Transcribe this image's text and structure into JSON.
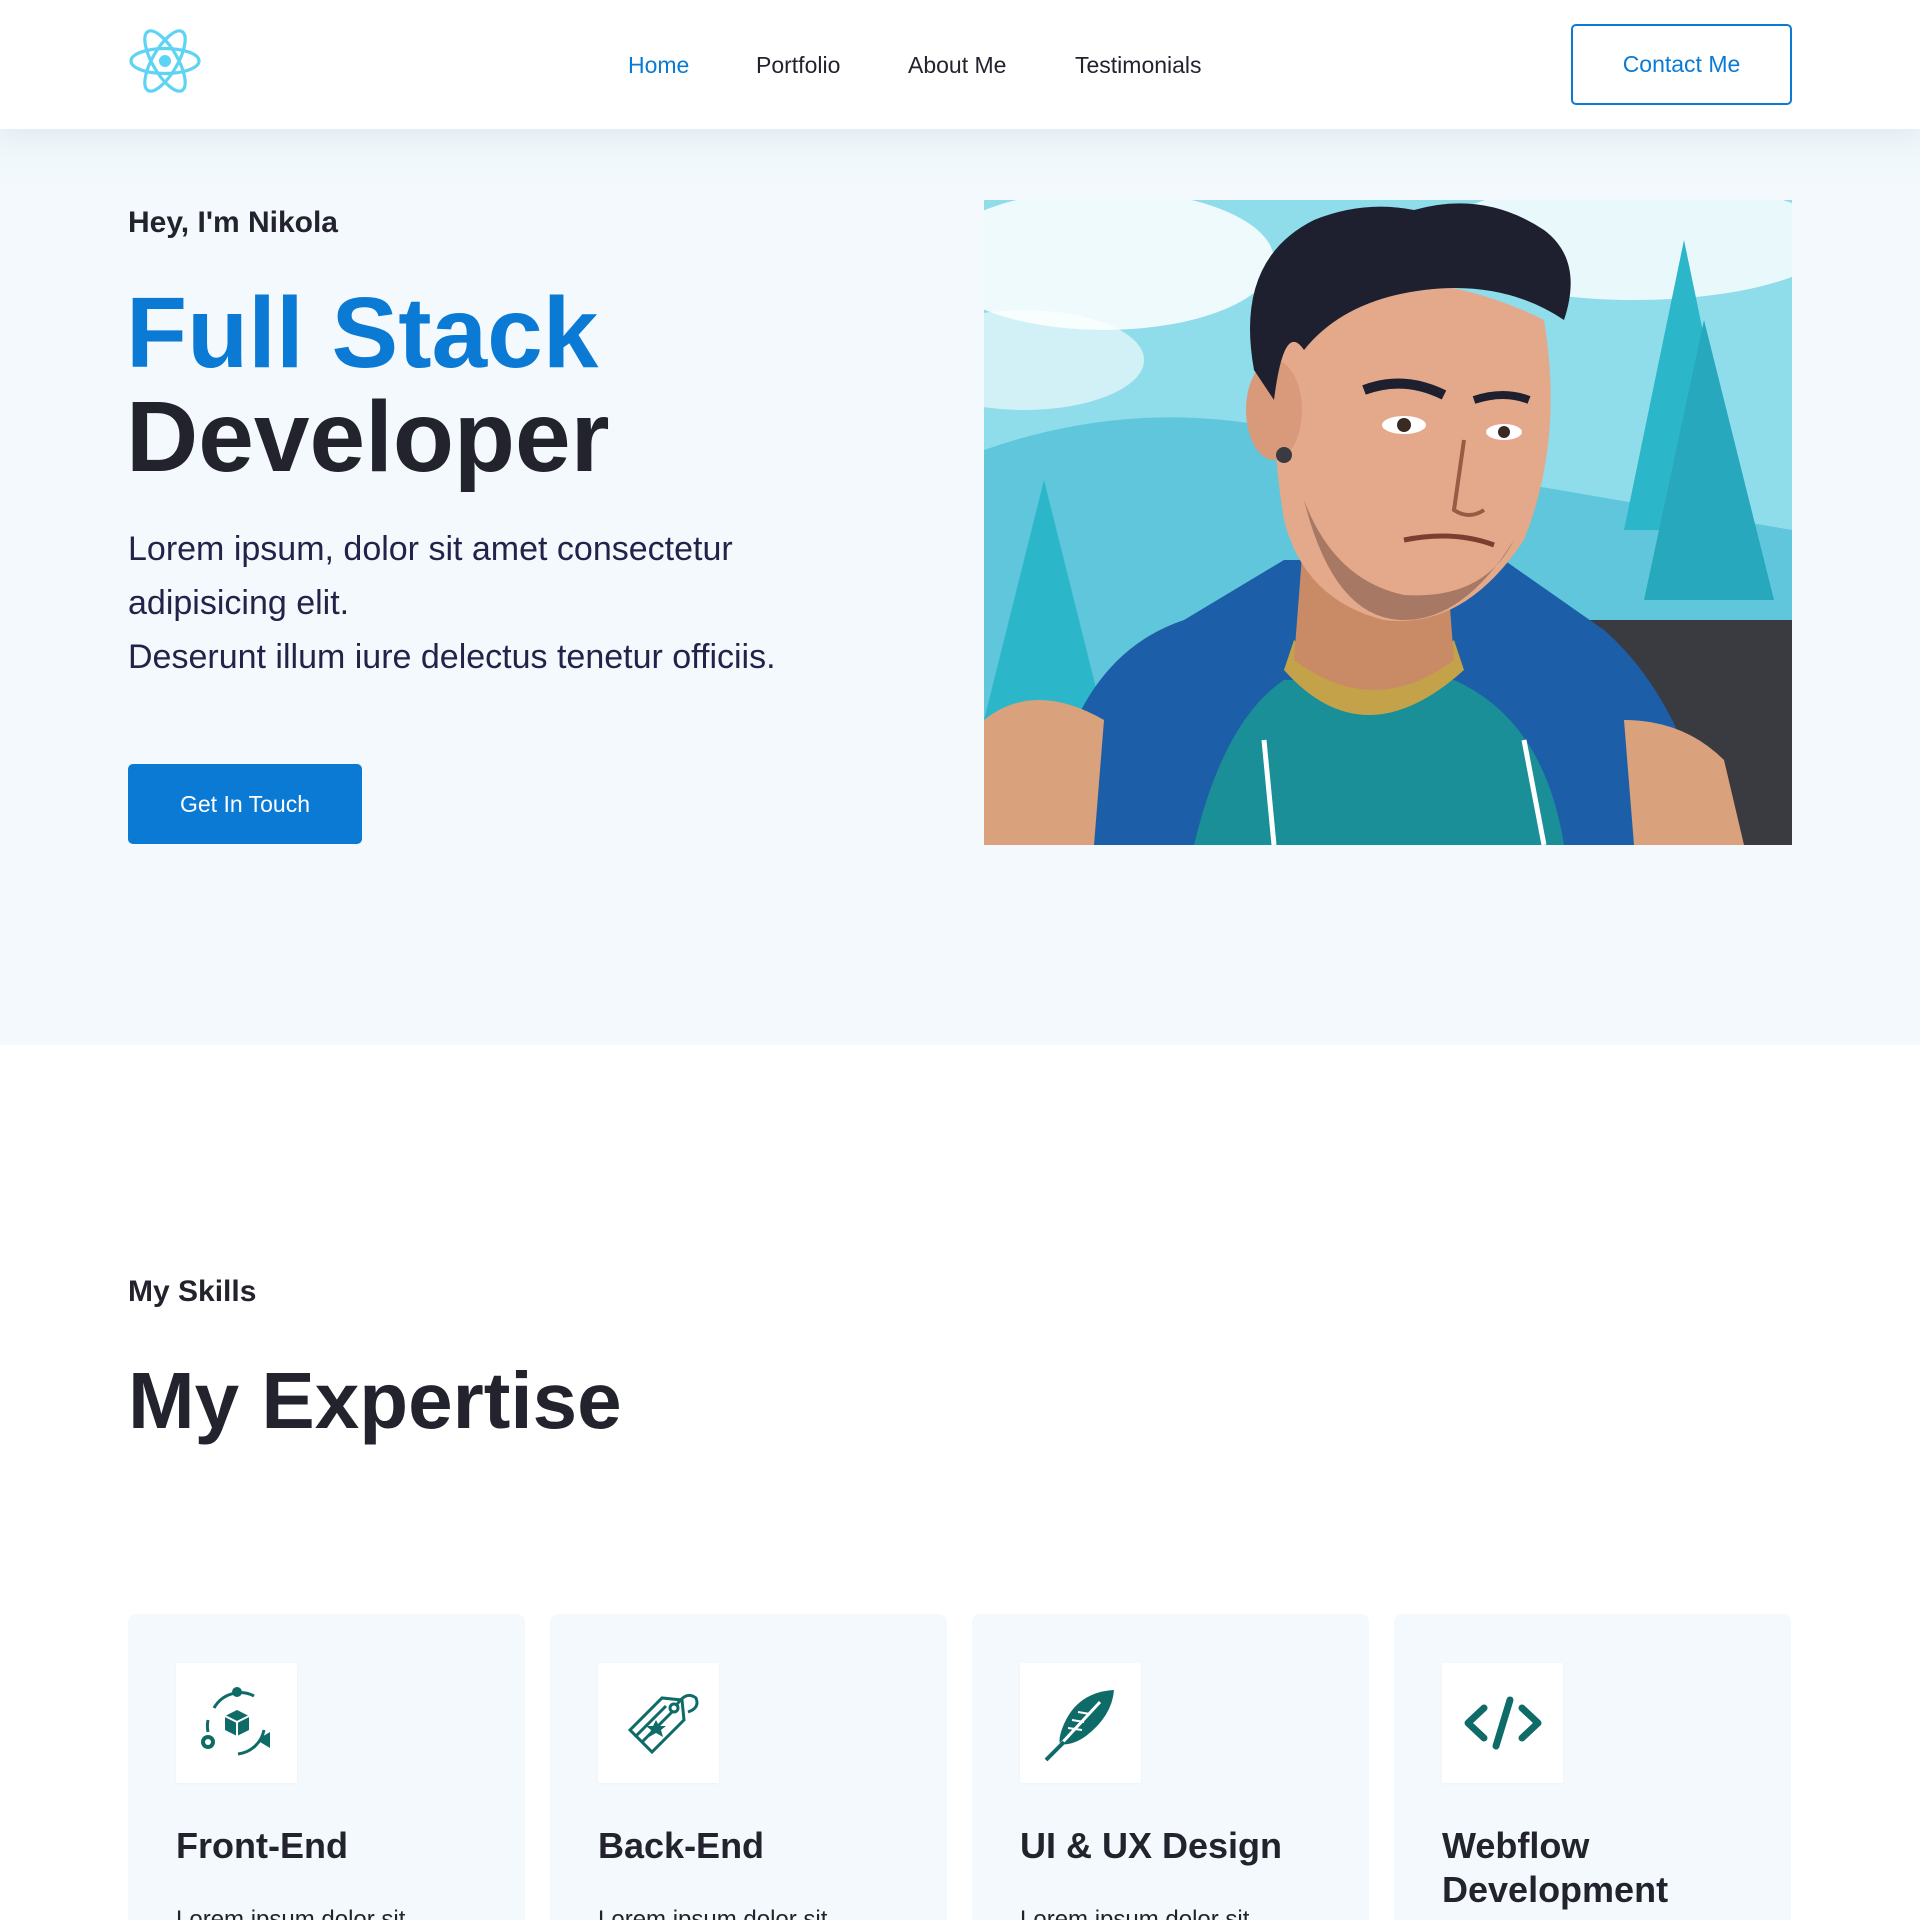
{
  "header": {
    "logo_icon": "react-atom-icon",
    "nav": [
      {
        "label": "Home",
        "active": true
      },
      {
        "label": "Portfolio",
        "active": false
      },
      {
        "label": "About Me",
        "active": false
      },
      {
        "label": "Testimonials",
        "active": false
      }
    ],
    "contact_label": "Contact Me"
  },
  "hero": {
    "kicker": "Hey, I'm Nikola",
    "title_accent": "Full Stack",
    "title_rest": "Developer",
    "description_lines": [
      "Lorem ipsum, dolor sit amet consectetur",
      "adipisicing elit.",
      "Deserunt illum iure delectus tenetur officiis."
    ],
    "cta_label": "Get In Touch",
    "image": "anime-style-developer-portrait"
  },
  "skills": {
    "kicker": "My Skills",
    "title": "My Expertise",
    "cards": [
      {
        "title": "Front-End",
        "icon": "product-cycle-icon",
        "text": "Lorem ipsum dolor sit"
      },
      {
        "title": "Back-End",
        "icon": "price-tag-icon",
        "text": "Lorem ipsum dolor sit"
      },
      {
        "title": "UI & UX Design",
        "icon": "feather-icon",
        "text": "Lorem ipsum dolor sit"
      },
      {
        "title": "Webflow Development",
        "icon": "code-icon",
        "text": ""
      }
    ]
  },
  "colors": {
    "accent": "#0a7ad4",
    "text_dark": "#23232e",
    "hero_bg": "#f3f9fd",
    "icon_teal": "#0f6b68",
    "logo_cyan": "#5ed3f3"
  }
}
